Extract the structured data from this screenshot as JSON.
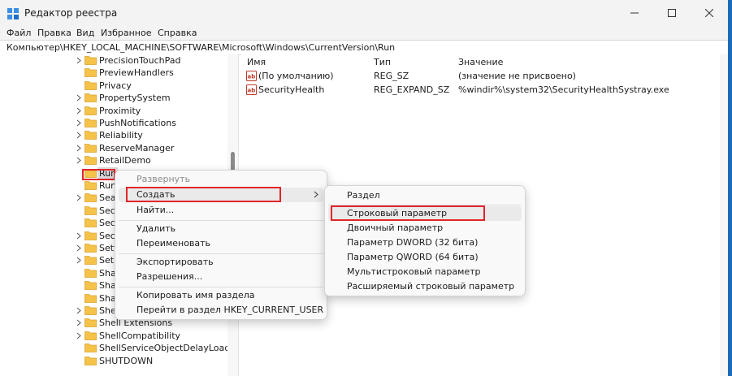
{
  "window": {
    "title": "Редактор реестра",
    "controls": [
      "minimize",
      "maximize",
      "close"
    ]
  },
  "menu": [
    "Файл",
    "Правка",
    "Вид",
    "Избранное",
    "Справка"
  ],
  "address": "Компьютер\\HKEY_LOCAL_MACHINE\\SOFTWARE\\Microsoft\\Windows\\CurrentVersion\\Run",
  "tree": {
    "items": [
      {
        "label": "PrecisionTouchPad",
        "expandable": true
      },
      {
        "label": "PreviewHandlers",
        "expandable": false
      },
      {
        "label": "Privacy",
        "expandable": false
      },
      {
        "label": "PropertySystem",
        "expandable": true
      },
      {
        "label": "Proximity",
        "expandable": true
      },
      {
        "label": "PushNotifications",
        "expandable": true
      },
      {
        "label": "Reliability",
        "expandable": true
      },
      {
        "label": "ReserveManager",
        "expandable": true
      },
      {
        "label": "RetailDemo",
        "expandable": true
      },
      {
        "label": "Run",
        "expandable": false,
        "selected": true
      },
      {
        "label": "Run",
        "expandable": false
      },
      {
        "label": "Sea",
        "expandable": true
      },
      {
        "label": "Sec",
        "expandable": false
      },
      {
        "label": "Sec",
        "expandable": false
      },
      {
        "label": "Sec",
        "expandable": true
      },
      {
        "label": "Sett",
        "expandable": true
      },
      {
        "label": "Setu",
        "expandable": true
      },
      {
        "label": "Sha",
        "expandable": false
      },
      {
        "label": "Sha",
        "expandable": false
      },
      {
        "label": "Sha",
        "expandable": false
      },
      {
        "label": "Shel",
        "expandable": true
      },
      {
        "label": "Shell Extensions",
        "expandable": true
      },
      {
        "label": "ShellCompatibility",
        "expandable": true
      },
      {
        "label": "ShellServiceObjectDelayLoad",
        "expandable": false
      },
      {
        "label": "SHUTDOWN",
        "expandable": false
      }
    ]
  },
  "list": {
    "columns": [
      "Имя",
      "Тип",
      "Значение"
    ],
    "rows": [
      {
        "name": "(По умолчанию)",
        "type": "REG_SZ",
        "value": "(значение не присвоено)"
      },
      {
        "name": "SecurityHealth",
        "type": "REG_EXPAND_SZ",
        "value": "%windir%\\system32\\SecurityHealthSystray.exe"
      }
    ]
  },
  "context_menu": {
    "items": {
      "expand": "Развернуть",
      "create": "Создать",
      "find": "Найти...",
      "delete": "Удалить",
      "rename": "Переименовать",
      "export": "Экспортировать",
      "permissions": "Разрешения...",
      "copy_key_name": "Копировать имя раздела",
      "goto_hkcu": "Перейти в раздел HKEY_CURRENT_USER"
    }
  },
  "submenu": {
    "items": {
      "key": "Раздел",
      "string": "Строковый параметр",
      "binary": "Двоичный параметр",
      "dword": "Параметр DWORD (32 бита)",
      "qword": "Параметр QWORD (64 бита)",
      "multi": "Мультистроковый параметр",
      "expandable": "Расширяемый строковый параметр"
    }
  },
  "colors": {
    "highlight": "#e0262b",
    "folder": "#f5c34a",
    "titlebar": "#f3f3f3"
  }
}
